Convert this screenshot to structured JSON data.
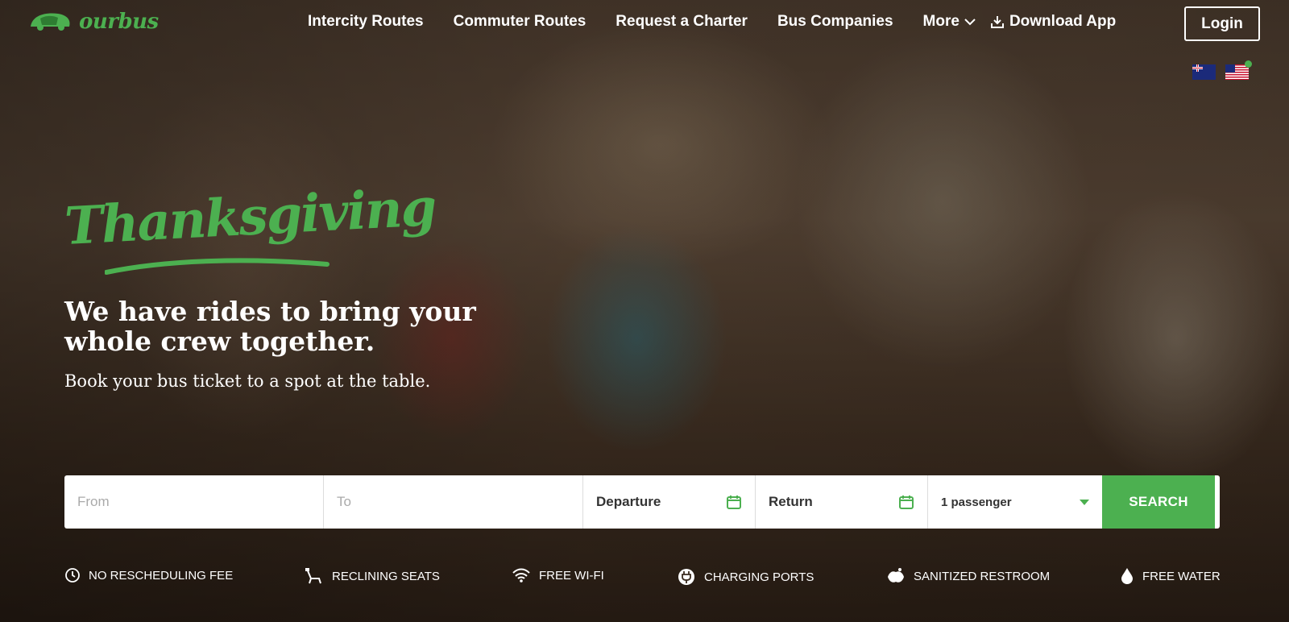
{
  "brand": {
    "name": "ourbus",
    "accent_color": "#4cb050",
    "logo_icon": "bus-logo-icon"
  },
  "nav": {
    "items": [
      "Intercity Routes",
      "Commuter Routes",
      "Request a Charter",
      "Bus Companies"
    ],
    "more_label": "More",
    "download_label": "Download App",
    "login_label": "Login"
  },
  "locale_flags": [
    "australia-flag-icon",
    "usa-flag-icon"
  ],
  "hero": {
    "promo_script": "Thanksgiving",
    "headline": "We have rides to bring your whole crew together.",
    "subheadline": "Book your bus ticket to a spot at the table."
  },
  "search": {
    "from_placeholder": "From",
    "to_placeholder": "To",
    "departure_label": "Departure",
    "return_label": "Return",
    "passengers_value": "1 passenger",
    "button_label": "SEARCH"
  },
  "amenities": [
    {
      "label": "NO RESCHEDULING FEE",
      "icon": "clock-icon"
    },
    {
      "label": "RECLINING SEATS",
      "icon": "seat-icon"
    },
    {
      "label": "FREE WI-FI",
      "icon": "wifi-icon"
    },
    {
      "label": "CHARGING PORTS",
      "icon": "plug-icon"
    },
    {
      "label": "SANITIZED RESTROOM",
      "icon": "hands-icon"
    },
    {
      "label": "FREE WATER",
      "icon": "water-drop-icon"
    }
  ]
}
